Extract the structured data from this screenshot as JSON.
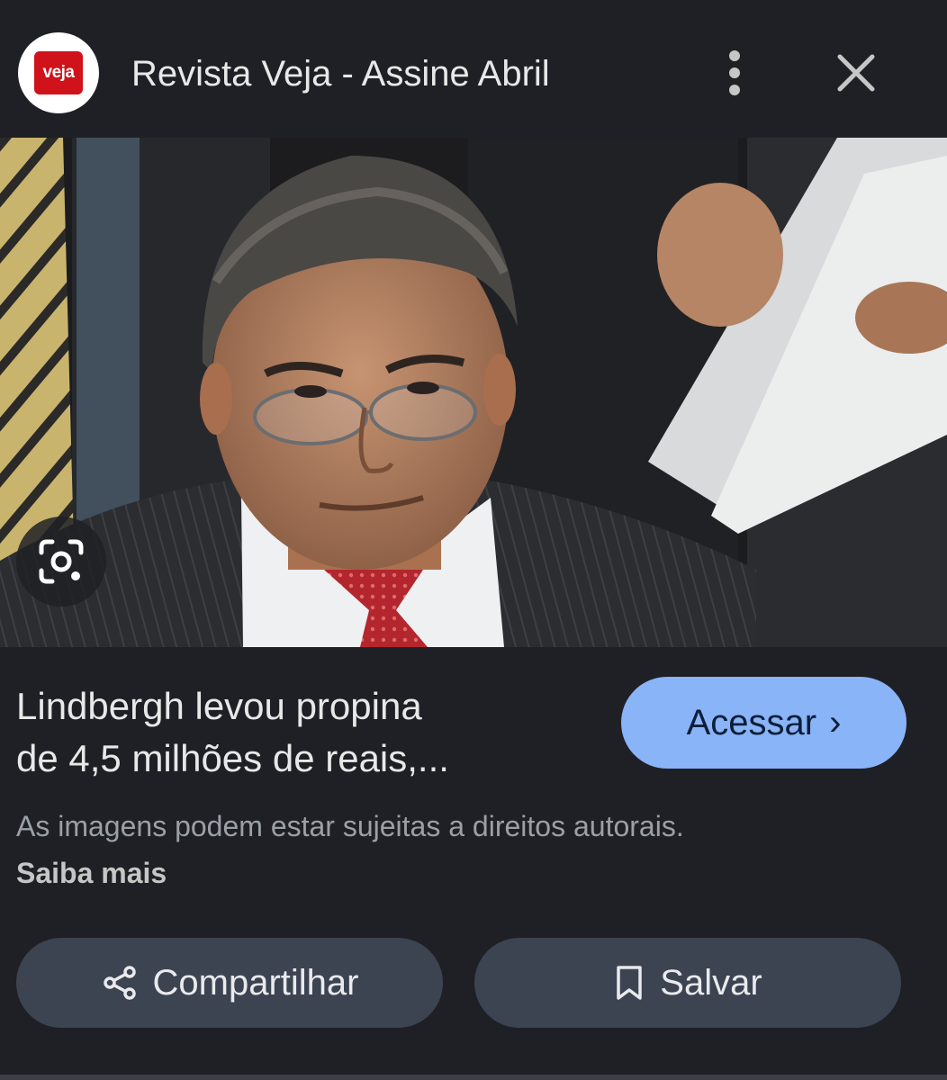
{
  "header": {
    "logo_text": "veja",
    "title": "Revista Veja - Assine Abril",
    "more_icon": "more-vert-icon",
    "close_icon": "close-icon"
  },
  "image": {
    "alt": "Lindbergh levou propina de 4,5 milhões de reais",
    "lens_icon": "google-lens-icon"
  },
  "result": {
    "headline_line1": "Lindbergh levou propina",
    "headline_line2": "de 4,5 milhões de reais,...",
    "visit_label": "Acessar",
    "visit_chevron": "›"
  },
  "disclaimer": {
    "text": "As imagens podem estar sujeitas a direitos autorais.",
    "learn_more": "Saiba mais"
  },
  "actions": {
    "share_label": "Compartilhar",
    "save_label": "Salvar"
  },
  "colors": {
    "background": "#1f2025",
    "accent_button": "#8ab4f8",
    "secondary_button": "#3c4351",
    "brand_red": "#d0121b"
  }
}
